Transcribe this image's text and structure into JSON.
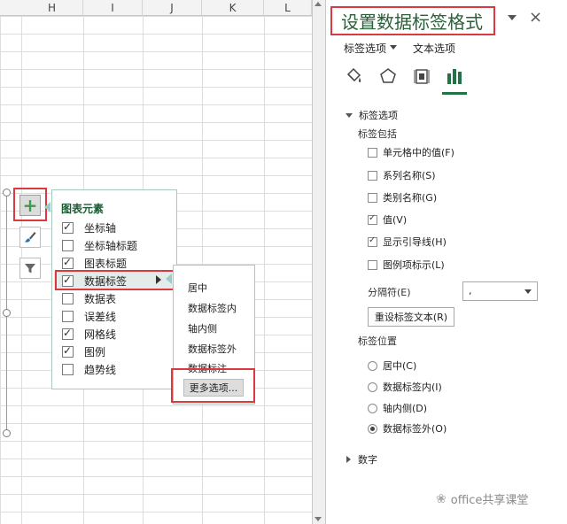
{
  "sheet": {
    "columns": [
      "H",
      "I",
      "J",
      "K",
      "L"
    ]
  },
  "chart_elements": {
    "title": "图表元素",
    "items": [
      {
        "label": "坐标轴",
        "checked": true
      },
      {
        "label": "坐标轴标题",
        "checked": false
      },
      {
        "label": "图表标题",
        "checked": true
      },
      {
        "label": "数据标签",
        "checked": true
      },
      {
        "label": "数据表",
        "checked": false
      },
      {
        "label": "误差线",
        "checked": false
      },
      {
        "label": "网格线",
        "checked": true
      },
      {
        "label": "图例",
        "checked": true
      },
      {
        "label": "趋势线",
        "checked": false
      }
    ]
  },
  "data_labels_submenu": {
    "items": [
      "居中",
      "数据标签内",
      "轴内侧",
      "数据标签外",
      "数据标注"
    ],
    "more_options": "更多选项..."
  },
  "format_pane": {
    "title": "设置数据标签格式",
    "tab_label_options": "标签选项",
    "tab_text_options": "文本选项",
    "icons": [
      "fill-bucket-icon",
      "pentagon-icon",
      "size-properties-icon",
      "bar-chart-icon"
    ],
    "section_label_options": "标签选项",
    "label_contains": "标签包括",
    "checks": [
      {
        "label": "单元格中的值(F)",
        "checked": false
      },
      {
        "label": "系列名称(S)",
        "checked": false
      },
      {
        "label": "类别名称(G)",
        "checked": false
      },
      {
        "label": "值(V)",
        "checked": true
      },
      {
        "label": "显示引导线(H)",
        "checked": true
      },
      {
        "label": "图例项标示(L)",
        "checked": false
      }
    ],
    "separator_label": "分隔符(E)",
    "separator_value": ",",
    "reset_button": "重设标签文本(R)",
    "label_position": "标签位置",
    "positions": [
      {
        "label": "居中(C)",
        "selected": false
      },
      {
        "label": "数据标签内(I)",
        "selected": false
      },
      {
        "label": "轴内侧(D)",
        "selected": false
      },
      {
        "label": "数据标签外(O)",
        "selected": true
      }
    ],
    "section_number": "数字"
  },
  "watermark": "office共享课堂",
  "colors": {
    "accent_green": "#217346",
    "highlight_red": "#d9393f",
    "title_green": "#2b5f3b"
  }
}
